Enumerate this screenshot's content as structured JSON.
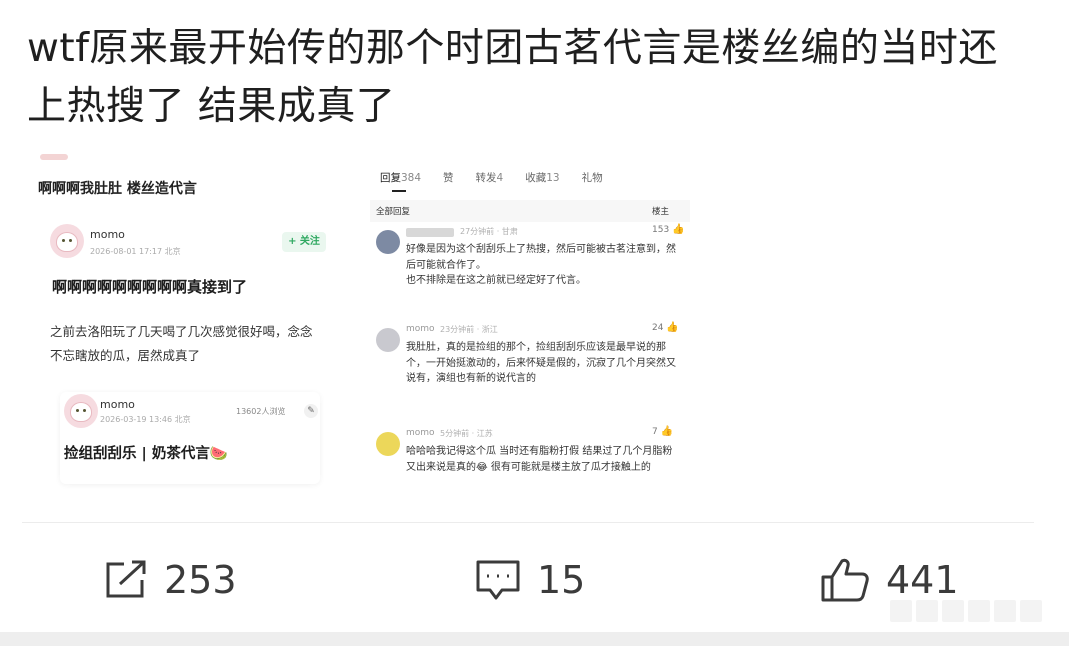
{
  "post": {
    "text": "wtf原来最开始传的那个时团古茗代言是楼丝编的当时还上热搜了 结果成真了"
  },
  "left_card": {
    "title": "啊啊啊我肚肚 楼丝造代言",
    "user": {
      "name": "momo",
      "meta": "2026-08-01 17:17  北京",
      "follow_label": "+ 关注"
    },
    "heading": "啊啊啊啊啊啊啊啊啊真接到了",
    "body": "之前去洛阳玩了几天喝了几次感觉很好喝，念念不忘瞎放的瓜，居然成真了",
    "sub_post": {
      "name": "momo",
      "meta": "2026-03-19 13:46  北京",
      "views": "13602人浏览",
      "title": "捡组刮刮乐 | 奶茶代言🍉"
    }
  },
  "right_card": {
    "tabs": [
      {
        "label": "回复",
        "count": "384"
      },
      {
        "label": "赞",
        "count": ""
      },
      {
        "label": "转发",
        "count": "4"
      },
      {
        "label": "收藏",
        "count": "13"
      },
      {
        "label": "礼物",
        "count": ""
      }
    ],
    "all_replies_label": "全部回复",
    "owner_label": "楼主",
    "comments": [
      {
        "name": "",
        "meta": "27分钟前 · 甘肃",
        "likes": "153",
        "text": "好像是因为这个刮刮乐上了热搜，然后可能被古茗注意到，然后可能就合作了。\n也不排除是在这之前就已经定好了代言。"
      },
      {
        "name": "momo",
        "meta": "23分钟前 · 浙江",
        "likes": "24",
        "text": "我肚肚，真的是捡组的那个，捡组刮刮乐应该是最早说的那个，一开始挺激动的，后来怀疑是假的，沉寂了几个月突然又说有，演组也有新的说代言的"
      },
      {
        "name": "momo",
        "meta": "5分钟前 · 江苏",
        "likes": "7",
        "text": "哈哈哈我记得这个瓜 当时还有脂粉打假 结果过了几个月脂粉又出来说是真的😂 很有可能就是楼主放了瓜才接触上的"
      }
    ]
  },
  "footer": {
    "share_count": "253",
    "comment_count": "15",
    "like_count": "441"
  },
  "colors": {
    "follow_green": "#2ea860",
    "avatar_pink": "#f6dbe0",
    "text_dark": "#1f1f1f"
  }
}
